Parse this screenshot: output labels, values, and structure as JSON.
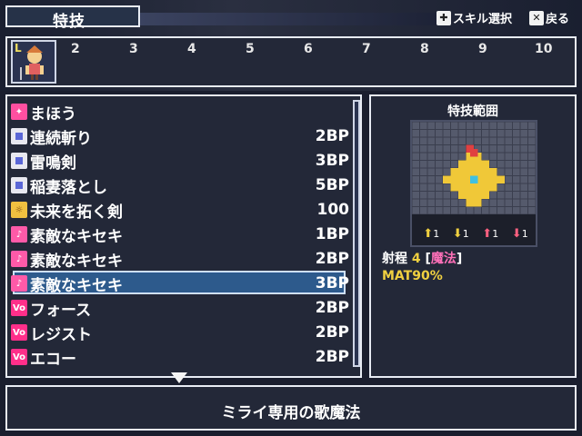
{
  "header": {
    "title": "特技",
    "hint_skill_select": "スキル選択",
    "hint_back": "戻る"
  },
  "party_strip": {
    "active_slot_marker": "L",
    "slot_numbers": [
      "2",
      "3",
      "4",
      "5",
      "6",
      "7",
      "8",
      "9",
      "10"
    ]
  },
  "skills": [
    {
      "name": "まほう",
      "cost": "",
      "icon": "magic-icon"
    },
    {
      "name": "連続斬り",
      "cost": "2BP",
      "icon": "skill-square-icon"
    },
    {
      "name": "雷鳴剣",
      "cost": "3BP",
      "icon": "skill-square-icon"
    },
    {
      "name": "稲妻落とし",
      "cost": "5BP",
      "icon": "skill-square-icon"
    },
    {
      "name": "未来を拓く剣",
      "cost": "100",
      "icon": "special-gold-icon"
    },
    {
      "name": "素敵なキセキ",
      "cost": "1BP",
      "icon": "music-note-icon"
    },
    {
      "name": "素敵なキセキ",
      "cost": "2BP",
      "icon": "music-note-plus-icon"
    },
    {
      "name": "素敵なキセキ",
      "cost": "3BP",
      "icon": "music-note-plus2-icon"
    },
    {
      "name": "フォース",
      "cost": "2BP",
      "icon": "vo-icon"
    },
    {
      "name": "レジスト",
      "cost": "2BP",
      "icon": "vo-icon"
    },
    {
      "name": "エコー",
      "cost": "2BP",
      "icon": "vo-icon"
    }
  ],
  "selected_index": 7,
  "range_panel": {
    "title": "特技範囲",
    "stat_counts": [
      "1",
      "1",
      "1",
      "1"
    ],
    "range_label": "射程",
    "range_value": "4",
    "range_type": "魔法",
    "range_open": "[",
    "range_close": "]",
    "mat": "MAT90%"
  },
  "description": "ミライ専用の歌魔法",
  "colors": {
    "panel_bg": "#232838",
    "border": "#e8ecf4",
    "selection": "#2d5a8c",
    "gold": "#f0d040",
    "pink": "#ff70b8"
  }
}
